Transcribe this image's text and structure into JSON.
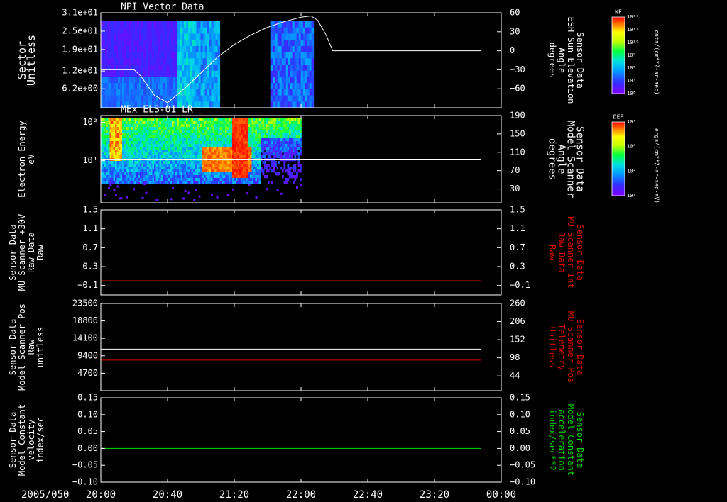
{
  "date_label": "2005/050",
  "x_ticks": [
    "20:00",
    "20:40",
    "21:20",
    "22:00",
    "22:40",
    "23:20",
    "00:00"
  ],
  "colors": {
    "frame": "#ffffff",
    "red_trace": "#dd0000",
    "green_trace": "#00dd00",
    "white_trace": "#ffffff"
  },
  "colorbars": [
    {
      "name": "NPI colorbar",
      "title": "NF",
      "unit": "cnts/(cm**2-sr-sec)",
      "ticks": [
        "10¹²",
        "10¹¹",
        "10¹⁰",
        "10⁹",
        "10⁸",
        "10⁷",
        "10⁶"
      ]
    },
    {
      "name": "ELS colorbar",
      "title": "DEF",
      "unit": "ergs/(cm**2-sr-sec-eV)",
      "ticks": [
        "10⁴",
        "10³",
        "10²",
        "10¹"
      ]
    }
  ],
  "chart_data": [
    {
      "type": "heatmap",
      "title": "NPI Vector Data",
      "ylabel": [
        "Sector",
        "Unitless"
      ],
      "ylim": [
        0,
        31
      ],
      "y_ticks": [
        "3.1e+01",
        "2.5e+01",
        "1.9e+01",
        "1.2e+01",
        "6.2e+00"
      ],
      "y_tick_values": [
        31,
        25,
        19,
        12,
        6.2
      ],
      "right_axis": {
        "label": [
          "Sensor Data",
          "ESH Sun Elevation",
          "Angle",
          "degrees"
        ],
        "ylim": [
          -90,
          60
        ],
        "ticks": [
          "60",
          "30",
          "0",
          "−30",
          "−60"
        ],
        "tick_values": [
          60,
          30,
          0,
          -30,
          -60
        ]
      },
      "data_intervals": [
        "20:00–20:47",
        "20:57–21:12",
        "21:37–21:57",
        "21:57–22:02"
      ],
      "series": [
        {
          "name": "ESH Sun Elevation Angle",
          "axis": "right",
          "color": "#ffffff",
          "x": [
            0,
            10,
            15,
            20,
            24,
            28,
            32,
            40,
            50,
            60,
            70,
            80,
            90,
            100,
            110,
            120,
            126,
            130,
            135,
            139,
            300
          ],
          "y": [
            -30,
            -30,
            -30,
            -30,
            -40,
            -55,
            -70,
            -82,
            -60,
            -35,
            -10,
            10,
            25,
            37,
            46,
            53,
            55,
            48,
            25,
            0,
            0
          ]
        }
      ]
    },
    {
      "type": "heatmap",
      "title": "MEx ELS-01 LR",
      "ylabel": [
        "Electron Energy",
        "eV"
      ],
      "y_scale": "log",
      "ylim": [
        0.8,
        150
      ],
      "y_ticks": [
        "10²",
        "10¹"
      ],
      "y_tick_values": [
        100,
        10
      ],
      "right_axis": {
        "label": [
          "Sensor Data",
          "Model Scanner",
          "Angle",
          "degrees"
        ],
        "ylim": [
          0,
          190
        ],
        "ticks": [
          "190",
          "150",
          "110",
          "70",
          "30"
        ],
        "tick_values": [
          190,
          150,
          110,
          70,
          30
        ]
      },
      "data_intervals": [
        "20:00–22:02"
      ],
      "series": [
        {
          "name": "Model Scanner Angle",
          "axis": "right",
          "color": "#ffffff",
          "x": [
            0,
            300
          ],
          "y": [
            95,
            95
          ]
        }
      ]
    },
    {
      "type": "line",
      "title": "",
      "ylabel": [
        "Sensor Data",
        "MU Scanner +30V",
        "Raw Data",
        "Raw"
      ],
      "ylim": [
        -0.3,
        1.5
      ],
      "y_ticks": [
        "1.5",
        "1.1",
        "0.7",
        "0.3",
        "−0.1"
      ],
      "y_tick_values": [
        1.5,
        1.1,
        0.7,
        0.3,
        -0.1
      ],
      "right_axis": {
        "label": [
          "Sensor Data",
          "MU Scanner Int",
          "Raw Data",
          "Raw"
        ],
        "ylim": [
          -0.3,
          1.5
        ],
        "ticks": [
          "1.5",
          "1.1",
          "0.7",
          "0.3",
          "−0.1"
        ],
        "tick_values": [
          1.5,
          1.1,
          0.7,
          0.3,
          -0.1
        ]
      },
      "series": [
        {
          "name": "MU Scanner Int",
          "axis": "right",
          "color": "#dd0000",
          "x": [
            0,
            240
          ],
          "y": [
            0.0,
            0.0
          ]
        }
      ]
    },
    {
      "type": "line",
      "title": "",
      "ylabel": [
        "Sensor Data",
        "Model Scanner Pos",
        "Raw",
        "unitless"
      ],
      "ylim": [
        0,
        23500
      ],
      "y_ticks": [
        "23500",
        "18800",
        "14100",
        "9400",
        "4700"
      ],
      "y_tick_values": [
        23500,
        18800,
        14100,
        9400,
        4700
      ],
      "right_axis": {
        "label": [
          "Sensor Data",
          "MU Scanner Pos",
          "Telemetry",
          "Unitless"
        ],
        "ylim": [
          0,
          260
        ],
        "ticks": [
          "260",
          "206",
          "152",
          "98",
          "44"
        ],
        "tick_values": [
          260,
          206,
          152,
          98,
          44
        ]
      },
      "series": [
        {
          "name": "Model Scanner Pos",
          "axis": "left",
          "color": "#ffffff",
          "x": [
            0,
            240
          ],
          "y": [
            11200,
            11200
          ]
        },
        {
          "name": "MU Scanner Pos",
          "axis": "right",
          "color": "#dd0000",
          "x": [
            0,
            240
          ],
          "y": [
            91,
            91
          ]
        }
      ]
    },
    {
      "type": "line",
      "title": "",
      "ylabel": [
        "Sensor Data",
        "Model Constant",
        "velocity",
        "index/sec"
      ],
      "ylim": [
        -0.1,
        0.15
      ],
      "y_ticks": [
        "0.15",
        "0.10",
        "0.05",
        "0.00",
        "−0.05",
        "−0.10"
      ],
      "y_tick_values": [
        0.15,
        0.1,
        0.05,
        0.0,
        -0.05,
        -0.1
      ],
      "right_axis": {
        "label": [
          "Sensor Data",
          "Model Constant",
          "acceleration",
          "index/sec**2"
        ],
        "ylim": [
          -0.1,
          0.15
        ],
        "ticks": [
          "0.15",
          "0.10",
          "0.05",
          "0.00",
          "−0.05",
          "−0.10"
        ],
        "tick_values": [
          0.15,
          0.1,
          0.05,
          0.0,
          -0.05,
          -0.1
        ]
      },
      "series": [
        {
          "name": "Model Constant acceleration",
          "axis": "right",
          "color": "#00dd00",
          "x": [
            0,
            240
          ],
          "y": [
            0.0,
            0.0
          ]
        }
      ]
    }
  ]
}
